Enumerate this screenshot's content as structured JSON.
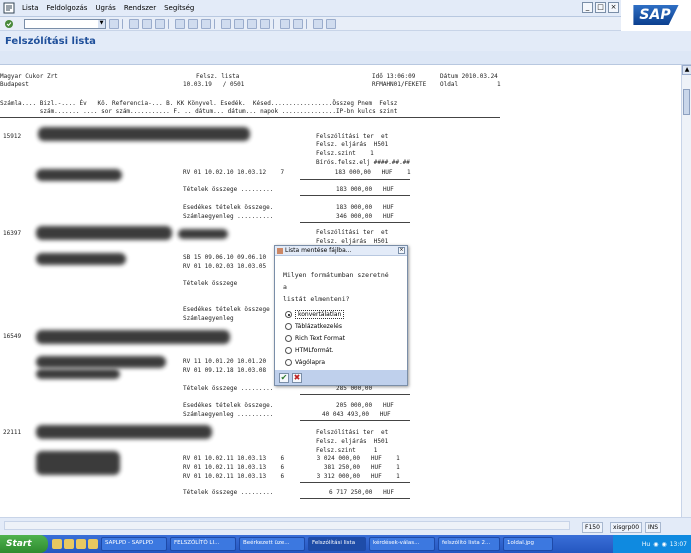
{
  "menu": {
    "items": [
      "Lista",
      "Feldolgozás",
      "Ugrás",
      "Rendszer",
      "Segítség"
    ]
  },
  "window": {
    "min": "_",
    "max": "□",
    "close": "×"
  },
  "sap_logo": "SAP",
  "title": "Felszólítási lista",
  "report": {
    "company": "Magyar Cukor Zrt",
    "city": "Budapest",
    "list_title": "Felsz. lista",
    "list_date": "10.03.19   / 0501",
    "time_label": "Idő 13:06:09",
    "date_label": "Dátum 2010.03.24",
    "user": "RFMAHN01/FEKETE",
    "page_label": "Oldal",
    "page_num": "1",
    "header1": "Számla.... Bizl.-.... Év   Kö. Referencia-... B. KK Könyvel. Esedék.  Késed.................Összeg Pnem  Felsz",
    "header2": "           szám....... .... sor szám........... F. .. dátum... dátum... napok ...............IP-bn kulcs szint"
  },
  "customers": [
    {
      "id": "15912",
      "lines": [
        "Felszólítási ter  et",
        "Felsz. eljárás  H501",
        "Felsz.szint    1",
        "Bírós.felsz.elj ####.##.##"
      ],
      "rows": [
        "RV 01 10.02.10 10.03.12    7              183 000,00   HUF    1"
      ],
      "sum_label": "Tételek összege .........",
      "sum_value": "183 000,00   HUF",
      "due_label": "Esedékes tételek összege.",
      "due_value": "183 000,00   HUF",
      "bal_label": "Számlaegyenleg ..........",
      "bal_value": "346 000,00   HUF"
    },
    {
      "id": "16397",
      "lines": [
        "Felszólítási ter  et",
        "Felsz. eljárás  H501"
      ],
      "rows": [
        "SB 15 09.06.10 09.06.10",
        "RV 01 10.02.03 10.03.05"
      ],
      "sum_label": "Tételek összege",
      "due_label": "Esedékes tételek összege",
      "bal_label": "Számlaegyenleg"
    },
    {
      "id": "16549",
      "rows": [
        "RV 11 10.01.20 10.01.20",
        "RV 01 09.12.18 10.03.08"
      ],
      "sum_label": "Tételek összege .........",
      "sum_value": "285 000,00",
      "due_label": "Esedékes tételek összege.",
      "due_value": "205 000,00   HUF",
      "bal_label": "Számlaegyenleg ..........",
      "bal_value": "40 043 493,00   HUF"
    },
    {
      "id": "22111",
      "lines": [
        "Felszólítási ter  et",
        "Felsz. eljárás  H501",
        "Felsz.szint     1"
      ],
      "rows": [
        "RV 01 10.02.11 10.03.13    6         3 024 000,00   HUF    1",
        "RV 01 10.02.11 10.03.13    6           381 250,00   HUF    1",
        "RV 01 10.02.11 10.03.13    6         3 312 000,00   HUF    1"
      ],
      "sum_label": "Tételek összege .........",
      "sum_value": "6 717 250,00   HUF"
    }
  ],
  "dialog": {
    "title": "Lista mentése fájlba...",
    "close": "×",
    "question1": "Milyen formátumban szeretné",
    "question2": "a",
    "question3": "listát elmenteni?",
    "options": [
      "konvertálatlan",
      "Táblázatkezelés",
      "Rich Text Format",
      "HTMLformát.",
      "Vágólapra"
    ],
    "selected": "konvertálatlan",
    "ok": "✔",
    "cancel": "✖"
  },
  "status": {
    "program": "F150",
    "server": "xisgrp00",
    "mode": "INS"
  },
  "taskbar": {
    "start": "Start",
    "tasks": [
      "SAPLPD - SAPLPD",
      "FELSZÓLÍTÓ LI...",
      "Beérkezett üze...",
      "Felszólítási lista",
      "kérdések-válas...",
      "felszólító lista 2...",
      "1oldal.jpg"
    ],
    "lang": "Hu",
    "time": "13:07"
  }
}
